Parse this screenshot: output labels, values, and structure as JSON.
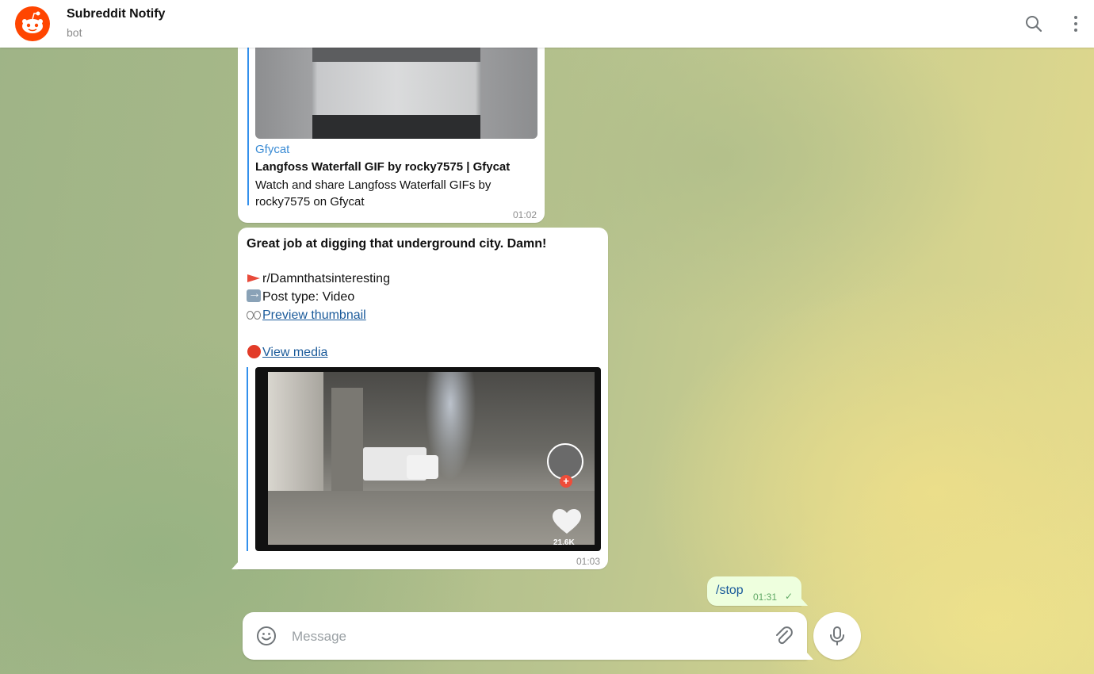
{
  "header": {
    "title": "Subreddit Notify",
    "subtitle": "bot",
    "avatar_icon": "reddit-snoo-icon",
    "search_icon": "search-icon",
    "more_icon": "more-vertical-icon",
    "brand_color": "#ff4500"
  },
  "messages": [
    {
      "type": "link_preview",
      "site_name": "Gfycat",
      "preview_title": "Langfoss Waterfall GIF by rocky7575 | Gfycat",
      "preview_description": "Watch and share Langfoss Waterfall GIFs by rocky7575 on Gfycat",
      "time": "01:02"
    },
    {
      "type": "post",
      "title": "Great job at digging that underground city. Damn!",
      "subreddit": "r/Damnthatsinteresting",
      "post_type": "Post type: Video",
      "preview_link": "Preview thumbnail",
      "media_link": "View media",
      "video_likes": "21.6K",
      "time": "01:03"
    },
    {
      "type": "outgoing",
      "text": "/stop",
      "time": "01:31",
      "status": "sent"
    }
  ],
  "composer": {
    "placeholder": "Message",
    "emoji_icon": "emoji-icon",
    "attach_icon": "attach-icon",
    "mic_icon": "microphone-icon"
  },
  "colors": {
    "link": "#1a5a9a",
    "site_name": "#3a8bd4",
    "accent_bar": "#3390ec",
    "outgoing_bubble": "#eeffde"
  }
}
